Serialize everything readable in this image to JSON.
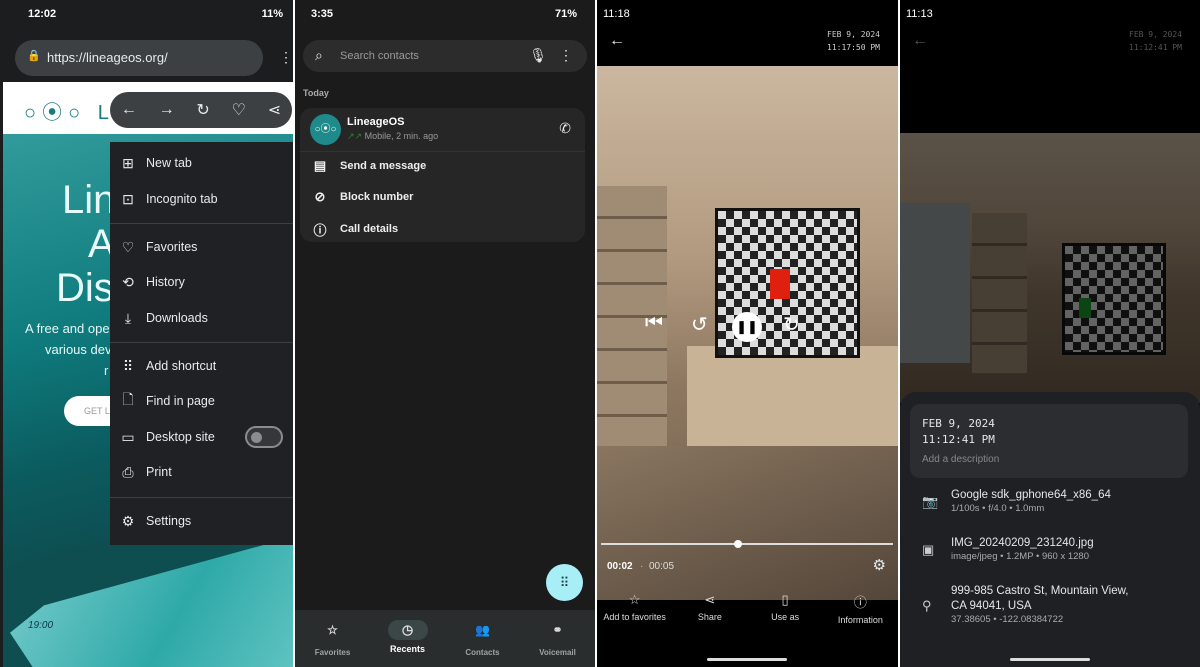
{
  "browser": {
    "status": {
      "time": "12:02",
      "battery": "11%"
    },
    "url": "https://lineageos.org/",
    "logo_text": "LIN",
    "hero": [
      "Lin",
      "A",
      "Dis"
    ],
    "subtitle": [
      "A free and ope",
      "various dev",
      "r"
    ],
    "cta": "GET L",
    "phone_time": "19:00",
    "toolbar": [
      "back-icon",
      "forward-icon",
      "reload-icon",
      "add-favorite-icon",
      "share-icon"
    ],
    "menu": [
      {
        "label": "New tab",
        "icon": "new-tab-icon"
      },
      {
        "label": "Incognito tab",
        "icon": "incognito-tab-icon"
      },
      {
        "label": "Favorites",
        "icon": "heart-icon"
      },
      {
        "label": "History",
        "icon": "history-icon"
      },
      {
        "label": "Downloads",
        "icon": "download-icon"
      },
      {
        "label": "Add shortcut",
        "icon": "grid-icon"
      },
      {
        "label": "Find in page",
        "icon": "find-icon"
      },
      {
        "label": "Desktop site",
        "icon": "monitor-icon",
        "toggle": false
      },
      {
        "label": "Print",
        "icon": "printer-icon"
      },
      {
        "label": "Settings",
        "icon": "gear-icon"
      }
    ]
  },
  "dialer": {
    "status": {
      "time": "3:35",
      "battery": "71%"
    },
    "search_placeholder": "Search contacts",
    "section": "Today",
    "call": {
      "name": "LineageOS",
      "detail": "Mobile, 2 min. ago"
    },
    "actions": [
      "Send a message",
      "Block number",
      "Call details"
    ],
    "nav": [
      {
        "label": "Favorites",
        "active": false
      },
      {
        "label": "Recents",
        "active": true
      },
      {
        "label": "Contacts",
        "active": false
      },
      {
        "label": "Voicemail",
        "active": false
      }
    ],
    "accent": "#a8eef6"
  },
  "video": {
    "status": {
      "time": "11:18"
    },
    "date": "FEB 9, 2024",
    "time": "11:17:50 PM",
    "position": "00:02",
    "duration": "00:05",
    "progress": 0.47,
    "actions": [
      "Add to favorites",
      "Share",
      "Use as",
      "Information"
    ]
  },
  "photo": {
    "status": {
      "time": "11:13"
    },
    "date": "FEB 9, 2024",
    "time": "11:12:41 PM",
    "description_placeholder": "Add a description",
    "camera": "Google sdk_gphone64_x86_64",
    "exposure": "1/100s • f/4.0 • 1.0mm",
    "filename": "IMG_20240209_231240.jpg",
    "fileinfo": "image/jpeg • 1.2MP • 960 x 1280",
    "address1": "999-985 Castro St, Mountain View,",
    "address2": "CA 94041, USA",
    "coords": "37.38605 • -122.08384722"
  }
}
